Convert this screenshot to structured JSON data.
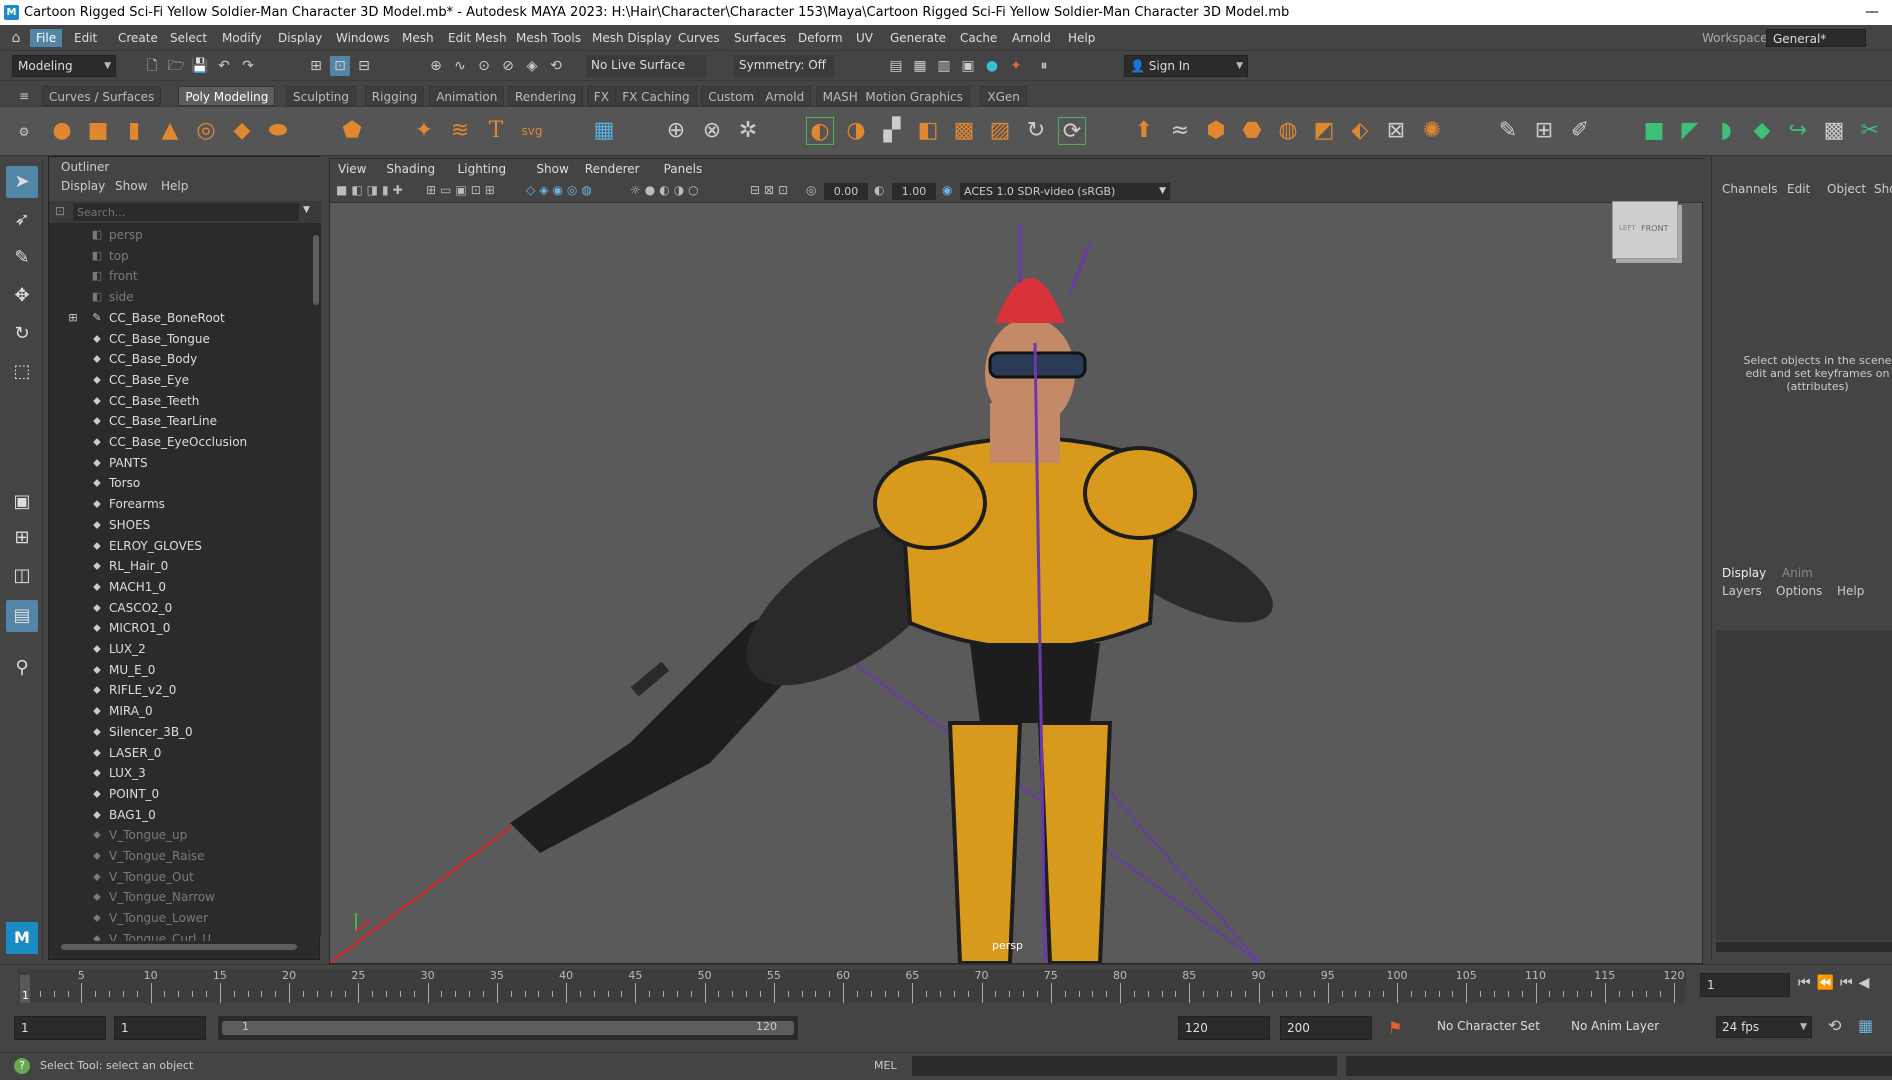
{
  "window": {
    "title": "Cartoon Rigged Sci-Fi Yellow Soldier-Man Character 3D Model.mb* - Autodesk MAYA 2023: H:\\Hair\\Character\\Character 153\\Maya\\Cartoon Rigged Sci-Fi Yellow Soldier-Man Character 3D Model.mb",
    "minimize": "—"
  },
  "menubar": {
    "items": [
      "File",
      "Edit",
      "Create",
      "Select",
      "Modify",
      "Display",
      "Windows",
      "Mesh",
      "Edit Mesh",
      "Mesh Tools",
      "Mesh Display",
      "Curves",
      "Surfaces",
      "Deform",
      "UV",
      "Generate",
      "Cache",
      "Arnold",
      "Help"
    ],
    "active": "File",
    "workspace_label": "Workspace:",
    "workspace_value": "General*"
  },
  "statusline": {
    "mode": "Modeling",
    "live_surface": "No Live Surface",
    "symmetry": "Symmetry: Off",
    "sign_in": "Sign In"
  },
  "shelf": {
    "tabs": [
      "Curves / Surfaces",
      "Poly Modeling",
      "Sculpting",
      "Rigging",
      "Animation",
      "Rendering",
      "FX",
      "FX Caching",
      "Custom",
      "Arnold",
      "MASH",
      "Motion Graphics",
      "XGen"
    ],
    "active_tab": "Poly Modeling"
  },
  "outliner": {
    "title": "Outliner",
    "menu": [
      "Display",
      "Show",
      "Help"
    ],
    "search_placeholder": "Search...",
    "items": [
      {
        "label": "persp",
        "icon": "camera-icon",
        "dim": true
      },
      {
        "label": "top",
        "icon": "camera-icon",
        "dim": true
      },
      {
        "label": "front",
        "icon": "camera-icon",
        "dim": true
      },
      {
        "label": "side",
        "icon": "camera-icon",
        "dim": true
      },
      {
        "label": "CC_Base_BoneRoot",
        "icon": "joint-icon",
        "dim": false,
        "expandable": true
      },
      {
        "label": "CC_Base_Tongue",
        "icon": "transform-icon",
        "dim": false
      },
      {
        "label": "CC_Base_Body",
        "icon": "transform-icon",
        "dim": false
      },
      {
        "label": "CC_Base_Eye",
        "icon": "transform-icon",
        "dim": false
      },
      {
        "label": "CC_Base_Teeth",
        "icon": "transform-icon",
        "dim": false
      },
      {
        "label": "CC_Base_TearLine",
        "icon": "transform-icon",
        "dim": false
      },
      {
        "label": "CC_Base_EyeOcclusion",
        "icon": "transform-icon",
        "dim": false
      },
      {
        "label": "PANTS",
        "icon": "transform-icon",
        "dim": false
      },
      {
        "label": "Torso",
        "icon": "transform-icon",
        "dim": false
      },
      {
        "label": "Forearms",
        "icon": "transform-icon",
        "dim": false
      },
      {
        "label": "SHOES",
        "icon": "transform-icon",
        "dim": false
      },
      {
        "label": "ELROY_GLOVES",
        "icon": "transform-icon",
        "dim": false
      },
      {
        "label": "RL_Hair_0",
        "icon": "transform-icon",
        "dim": false
      },
      {
        "label": "MACH1_0",
        "icon": "transform-icon",
        "dim": false
      },
      {
        "label": "CASCO2_0",
        "icon": "transform-icon",
        "dim": false
      },
      {
        "label": "MICRO1_0",
        "icon": "transform-icon",
        "dim": false
      },
      {
        "label": "LUX_2",
        "icon": "transform-icon",
        "dim": false
      },
      {
        "label": "MU_E_0",
        "icon": "transform-icon",
        "dim": false
      },
      {
        "label": "RIFLE_v2_0",
        "icon": "transform-icon",
        "dim": false
      },
      {
        "label": "MIRA_0",
        "icon": "transform-icon",
        "dim": false
      },
      {
        "label": "Silencer_3B_0",
        "icon": "transform-icon",
        "dim": false
      },
      {
        "label": "LASER_0",
        "icon": "transform-icon",
        "dim": false
      },
      {
        "label": "LUX_3",
        "icon": "transform-icon",
        "dim": false
      },
      {
        "label": "POINT_0",
        "icon": "transform-icon",
        "dim": false
      },
      {
        "label": "BAG1_0",
        "icon": "transform-icon",
        "dim": false
      },
      {
        "label": "V_Tongue_up",
        "icon": "transform-icon",
        "dim": true
      },
      {
        "label": "V_Tongue_Raise",
        "icon": "transform-icon",
        "dim": true
      },
      {
        "label": "V_Tongue_Out",
        "icon": "transform-icon",
        "dim": true
      },
      {
        "label": "V_Tongue_Narrow",
        "icon": "transform-icon",
        "dim": true
      },
      {
        "label": "V_Tongue_Lower",
        "icon": "transform-icon",
        "dim": true
      },
      {
        "label": "V_Tongue_Curl_U",
        "icon": "transform-icon",
        "dim": true
      }
    ]
  },
  "viewport": {
    "menu": [
      "View",
      "Shading",
      "Lighting",
      "Show",
      "Renderer",
      "Panels"
    ],
    "exposure": "0.00",
    "gamma": "1.00",
    "color_space": "ACES 1.0 SDR-video (sRGB)",
    "camera_label": "persp",
    "viewcube_front": "FRONT",
    "viewcube_left": "LEFT"
  },
  "channelbox": {
    "menu": [
      "Channels",
      "Edit",
      "Object",
      "Sho"
    ],
    "message": "Select objects in the scene edit and set keyframes on (attributes)",
    "layer_tabs": [
      "Display",
      "Anim"
    ],
    "layer_menu": [
      "Layers",
      "Options",
      "Help"
    ]
  },
  "timeline": {
    "ticks": [
      "5",
      "10",
      "15",
      "20",
      "25",
      "30",
      "35",
      "40",
      "45",
      "50",
      "55",
      "60",
      "65",
      "70",
      "75",
      "80",
      "85",
      "90",
      "95",
      "100",
      "105",
      "110",
      "115",
      "120"
    ],
    "current_frame_marker": "1",
    "current_frame_field": "1"
  },
  "range": {
    "start": "1",
    "playback_start": "1",
    "slider_start": "1",
    "slider_end": "120",
    "playback_end": "120",
    "end": "200",
    "character_set": "No Character Set",
    "anim_layer": "No Anim Layer",
    "fps": "24 fps"
  },
  "commandline": {
    "help": "Select Tool: select an object",
    "language": "MEL"
  },
  "colors": {
    "accent": "#5285a6",
    "panel": "#444444",
    "viewport": "#5a5a5a",
    "suit_yellow": "#d89a1c",
    "hair_red": "#d8323a"
  }
}
